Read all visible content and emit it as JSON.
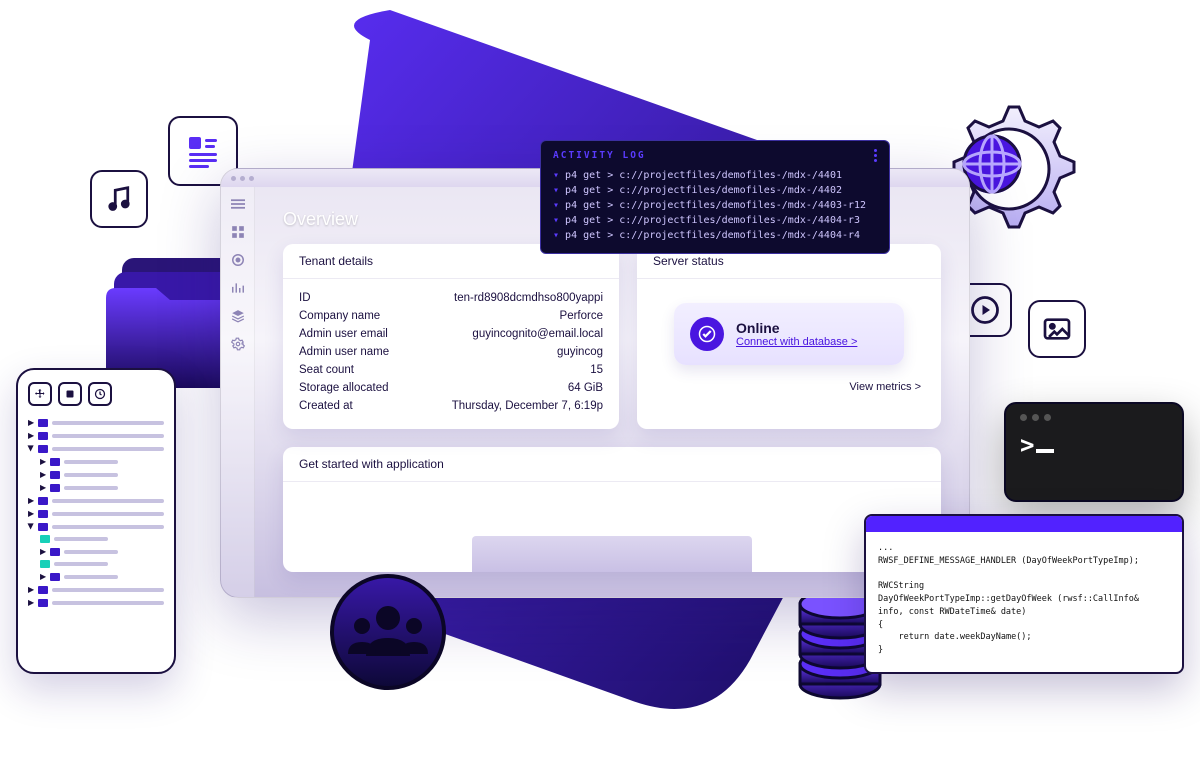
{
  "overview_title": "Overview",
  "tenant": {
    "title": "Tenant details",
    "rows": [
      {
        "k": "ID",
        "v": "ten-rd8908dcmdhso800yappi"
      },
      {
        "k": "Company name",
        "v": "Perforce"
      },
      {
        "k": "Admin user email",
        "v": "guyincognito@email.local"
      },
      {
        "k": "Admin user name",
        "v": "guyincog"
      },
      {
        "k": "Seat count",
        "v": "15"
      },
      {
        "k": "Storage allocated",
        "v": "64 GiB"
      },
      {
        "k": "Created at",
        "v": "Thursday, December 7, 6:19p"
      }
    ]
  },
  "server": {
    "title": "Server status",
    "status": "Online",
    "connect": "Connect with database >",
    "metrics": "View metrics >"
  },
  "get_started": {
    "title": "Get started with application"
  },
  "activity_log": {
    "title": "ACTIVITY LOG",
    "lines": [
      "p4 get > c://projectfiles/demofiles-/mdx-/4401",
      "p4 get > c://projectfiles/demofiles-/mdx-/4402",
      "p4 get > c://projectfiles/demofiles-/mdx-/4403-r12",
      "p4 get > c://projectfiles/demofiles-/mdx-/4404-r3",
      "p4 get > c://projectfiles/demofiles-/mdx-/4404-r4"
    ]
  },
  "terminal_prompt": ">_",
  "code": "...\nRWSF_DEFINE_MESSAGE_HANDLER (DayOfWeekPortTypeImp);\n\nRWCString\nDayOfWeekPortTypeImp::getDayOfWeek (rwsf::CallInfo&\ninfo, const RWDateTime& date)\n{\n    return date.weekDayName();\n}"
}
